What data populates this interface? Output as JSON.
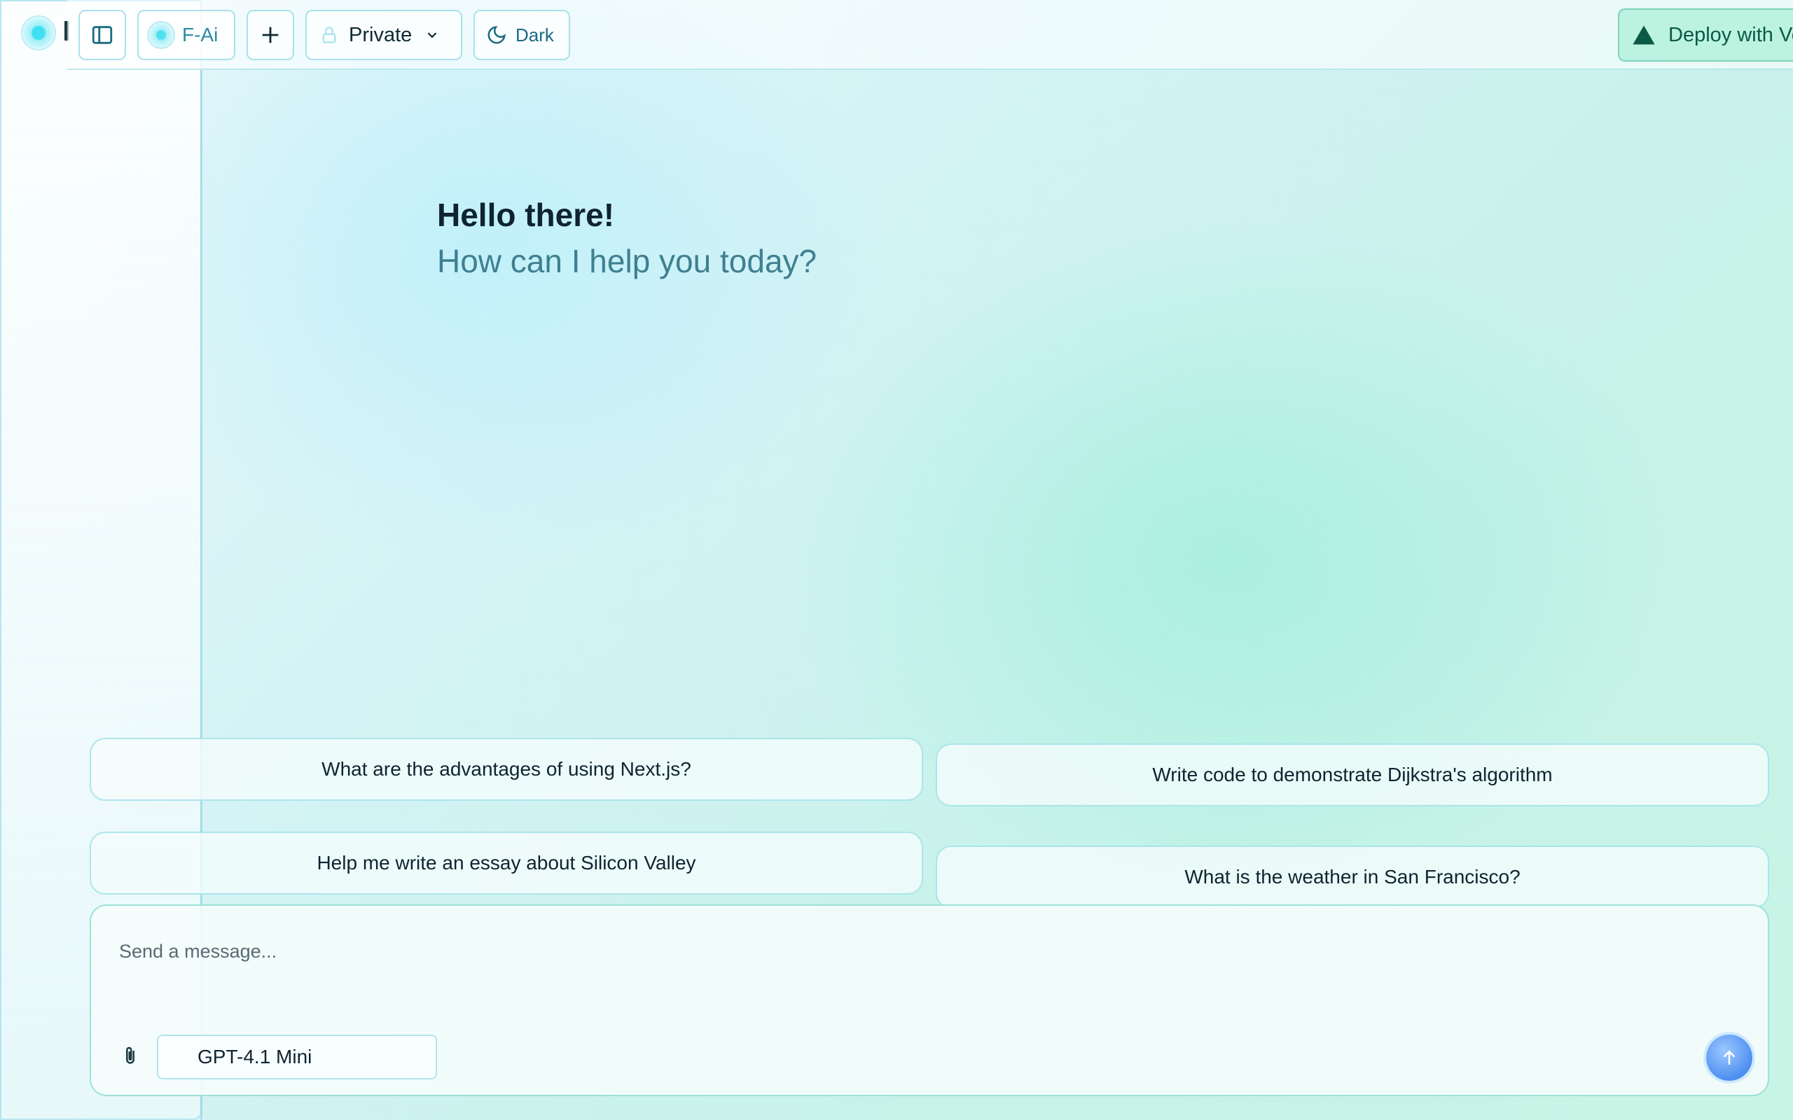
{
  "sidebar": {
    "logo_icon": "app-logo-icon"
  },
  "header": {
    "model_label": "F-Ai",
    "visibility_label": "Private",
    "theme_label": "Dark",
    "deploy_label": "Deploy with Vercel",
    "icons": [
      "sidebar-toggle-icon",
      "plus-icon",
      "lock-icon",
      "chevron-down-icon",
      "moon-icon",
      "vercel-triangle-icon"
    ]
  },
  "greeting": {
    "title": "Hello there!",
    "subtitle": "How can I help you today?"
  },
  "suggestions": [
    "What are the advantages of using Next.js?",
    "Write code to demonstrate Dijkstra's algorithm",
    "Help me write an essay about Silicon Valley",
    "What is the weather in San Francisco?"
  ],
  "composer": {
    "placeholder": "Send a message...",
    "model": "GPT-4.1 Mini",
    "icons": [
      "paperclip-icon",
      "arrow-up-icon"
    ]
  },
  "colors": {
    "accent": "#2a8aa3",
    "deploy_bg": "#b4f0dc",
    "deploy_text": "#0a5a45",
    "send_button": "#4f8ff2"
  }
}
